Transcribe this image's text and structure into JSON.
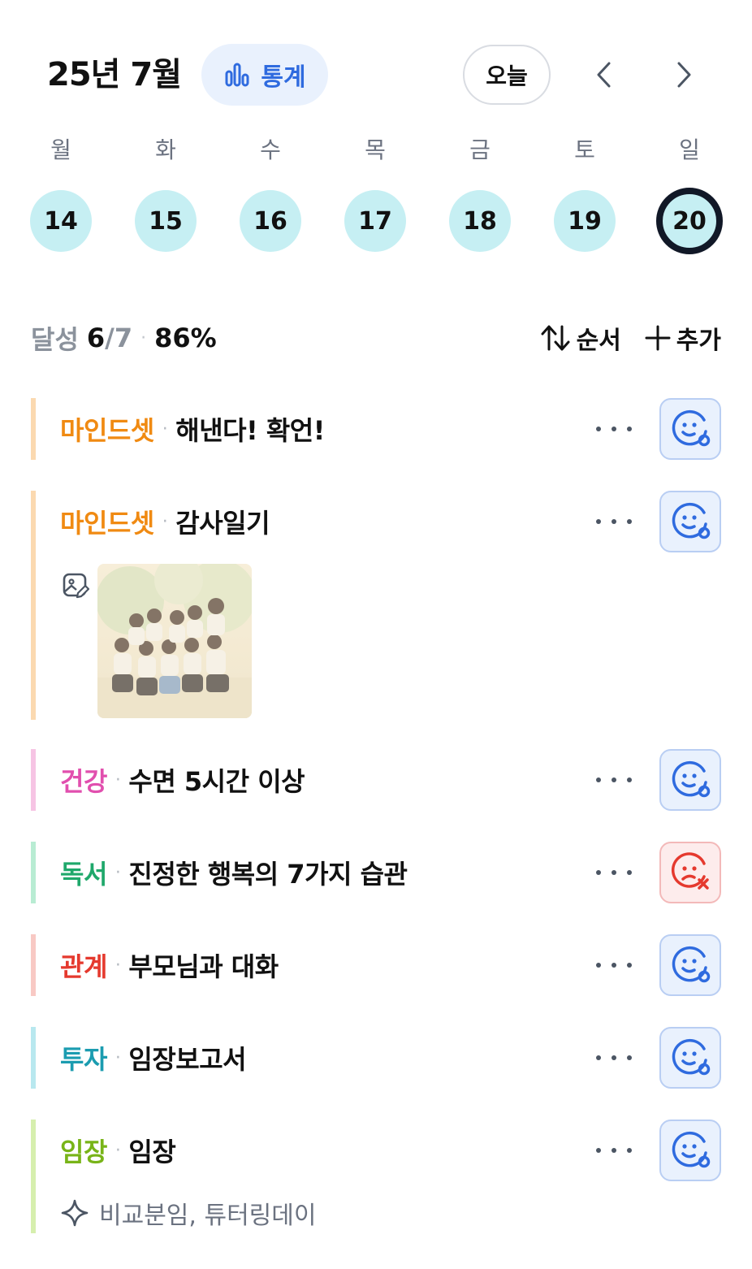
{
  "header": {
    "month_title": "25년 7월",
    "stats_label": "통계",
    "today_label": "오늘"
  },
  "week": {
    "days": [
      {
        "weekday": "월",
        "date": "14"
      },
      {
        "weekday": "화",
        "date": "15"
      },
      {
        "weekday": "수",
        "date": "16"
      },
      {
        "weekday": "목",
        "date": "17"
      },
      {
        "weekday": "금",
        "date": "18"
      },
      {
        "weekday": "토",
        "date": "19"
      },
      {
        "weekday": "일",
        "date": "20"
      }
    ],
    "selected_date": "20"
  },
  "summary": {
    "label": "달성",
    "done": "6",
    "total": "/7",
    "percent": "86%",
    "sort_label": "순서",
    "add_label": "추가"
  },
  "habits": [
    {
      "category": "마인드셋",
      "name": "해낸다! 확언!",
      "color": "#f08a12",
      "bar_color": "#fbd9b0",
      "status": "success"
    },
    {
      "category": "마인드셋",
      "name": "감사일기",
      "color": "#f08a12",
      "bar_color": "#fbd9b0",
      "status": "success",
      "has_photo": true
    },
    {
      "category": "건강",
      "name": "수면 5시간 이상",
      "color": "#e14fae",
      "bar_color": "#f6c4e4",
      "status": "success"
    },
    {
      "category": "독서",
      "name": "진정한 행복의 7가지 습관",
      "color": "#1fa86b",
      "bar_color": "#b8ecd3",
      "status": "fail"
    },
    {
      "category": "관계",
      "name": "부모님과 대화",
      "color": "#e5392e",
      "bar_color": "#f8c9c4",
      "status": "success"
    },
    {
      "category": "투자",
      "name": "임장보고서",
      "color": "#1b9cb0",
      "bar_color": "#b8e8ef",
      "status": "success"
    },
    {
      "category": "임장",
      "name": "임장",
      "color": "#78b418",
      "bar_color": "#d6efae",
      "status": "success",
      "note": "비교분임, 튜터링데이"
    }
  ],
  "colors": {
    "accent": "#2f6bdf",
    "success_bg": "#e9f1fd",
    "fail_bg": "#fdecec",
    "fail": "#e5392e",
    "date_bg": "#c6eff3"
  }
}
